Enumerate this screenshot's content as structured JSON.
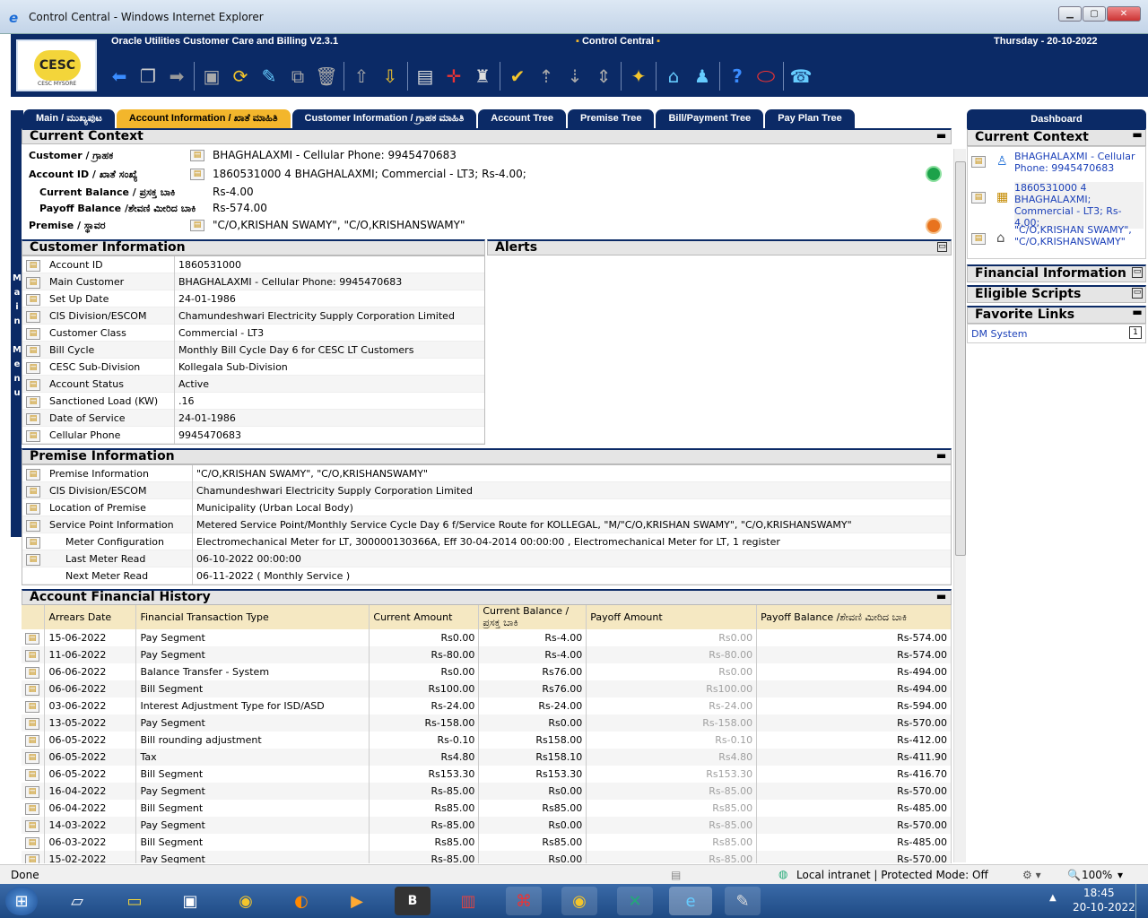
{
  "window": {
    "title": "Control Central - Windows Internet Explorer"
  },
  "banner": {
    "app": "Oracle Utilities Customer Care and Billing V2.3.1",
    "portal": "Control Central",
    "date": "Thursday - 20-10-2022",
    "logo_text": "CESC MYSORE"
  },
  "toolbar_icons": [
    "back-arrow-icon",
    "copy-icon",
    "forward-arrow-icon",
    "save-icon",
    "refresh-icon",
    "clear-icon",
    "duplicate-icon",
    "delete-icon",
    "previous-record-icon",
    "next-record-icon",
    "context-menu-icon",
    "to-do-icon",
    "user-icon",
    "approve-icon",
    "up-icon",
    "down-icon",
    "sort-icon",
    "wand-icon",
    "home-icon",
    "bookmark-icon",
    "help-icon",
    "oracle-icon",
    "phone-icon"
  ],
  "side_menu": "Main Menu",
  "tabs": [
    "Main / ಮುಖ್ಯಪುಟ",
    "Account Information / ಖಾತೆ ಮಾಹಿತಿ",
    "Customer Information / ಗ್ರಾಹಕ ಮಾಹಿತಿ",
    "Account Tree",
    "Premise Tree",
    "Bill/Payment Tree",
    "Pay Plan Tree"
  ],
  "current_context": {
    "title": "Current Context",
    "customer_label": "Customer / ಗ್ರಾಹಕ",
    "customer_value": "BHAGHALAXMI - Cellular Phone: 9945470683",
    "account_label": "Account ID / ಖಾತೆ ಸಂಖ್ಯೆ",
    "account_value": "1860531000 4 BHAGHALAXMI; Commercial - LT3; Rs-4.00;",
    "balance_label": "Current Balance / ಪ್ರಸಕ್ತ ಬಾಕಿ",
    "balance_value": "Rs-4.00",
    "payoff_label": "Payoff Balance /ಶೇವಣಿ ಮೀರಿದ ಬಾಕಿ",
    "payoff_value": "Rs-574.00",
    "premise_label": "Premise / ಸ್ಥಾವರ",
    "premise_value": "\"C/O,KRISHAN SWAMY\", \"C/O,KRISHANSWAMY\""
  },
  "customer_info": {
    "title": "Customer Information",
    "rows": [
      [
        "Account ID",
        "1860531000"
      ],
      [
        "Main Customer",
        "BHAGHALAXMI - Cellular Phone: 9945470683"
      ],
      [
        "Set Up Date",
        "24-01-1986"
      ],
      [
        "CIS Division/ESCOM",
        "Chamundeshwari Electricity Supply Corporation Limited"
      ],
      [
        "Customer Class",
        "Commercial - LT3"
      ],
      [
        "Bill Cycle",
        "Monthly Bill Cycle Day 6 for CESC LT Customers"
      ],
      [
        "CESC Sub-Division",
        "Kollegala Sub-Division"
      ],
      [
        "Account Status",
        "Active"
      ],
      [
        "Sanctioned Load (KW)",
        ".16"
      ],
      [
        "Date of Service",
        "24-01-1986"
      ],
      [
        "Cellular Phone",
        "9945470683"
      ]
    ]
  },
  "alerts": {
    "title": "Alerts"
  },
  "premise_info": {
    "title": "Premise Information",
    "rows": [
      [
        "Premise Information",
        "\"C/O,KRISHAN SWAMY\", \"C/O,KRISHANSWAMY\""
      ],
      [
        "CIS Division/ESCOM",
        "Chamundeshwari Electricity Supply Corporation Limited"
      ],
      [
        "Location of Premise",
        "Municipality (Urban Local Body)"
      ],
      [
        "Service Point Information",
        "Metered Service Point/Monthly Service Cycle Day 6 f/Service Route for KOLLEGAL, \"M/\"C/O,KRISHAN SWAMY\", \"C/O,KRISHANSWAMY\""
      ],
      [
        "Meter Configuration",
        "Electromechanical Meter for LT, 300000130366A, Eff 30-04-2014 00:00:00 , Electromechanical Meter for LT, 1 register"
      ],
      [
        "Last Meter Read",
        "06-10-2022 00:00:00"
      ],
      [
        "Next Meter Read",
        "06-11-2022 ( Monthly Service )"
      ]
    ]
  },
  "financial_history": {
    "title": "Account Financial History",
    "columns": [
      "Arrears Date",
      "Financial Transaction Type",
      "Current Amount",
      "Current Balance / ಪ್ರಸಕ್ತ ಬಾಕಿ",
      "Payoff Amount",
      "Payoff Balance /ಶೇವಣಿ ಮೀರಿದ ಬಾಕಿ"
    ],
    "rows": [
      [
        "15-06-2022",
        "Pay Segment",
        "Rs0.00",
        "Rs-4.00",
        "Rs0.00",
        "Rs-574.00"
      ],
      [
        "11-06-2022",
        "Pay Segment",
        "Rs-80.00",
        "Rs-4.00",
        "Rs-80.00",
        "Rs-574.00"
      ],
      [
        "06-06-2022",
        "Balance Transfer - System",
        "Rs0.00",
        "Rs76.00",
        "Rs0.00",
        "Rs-494.00"
      ],
      [
        "06-06-2022",
        "Bill Segment",
        "Rs100.00",
        "Rs76.00",
        "Rs100.00",
        "Rs-494.00"
      ],
      [
        "03-06-2022",
        "Interest Adjustment Type for ISD/ASD",
        "Rs-24.00",
        "Rs-24.00",
        "Rs-24.00",
        "Rs-594.00"
      ],
      [
        "13-05-2022",
        "Pay Segment",
        "Rs-158.00",
        "Rs0.00",
        "Rs-158.00",
        "Rs-570.00"
      ],
      [
        "06-05-2022",
        "Bill rounding adjustment",
        "Rs-0.10",
        "Rs158.00",
        "Rs-0.10",
        "Rs-412.00"
      ],
      [
        "06-05-2022",
        "Tax",
        "Rs4.80",
        "Rs158.10",
        "Rs4.80",
        "Rs-411.90"
      ],
      [
        "06-05-2022",
        "Bill Segment",
        "Rs153.30",
        "Rs153.30",
        "Rs153.30",
        "Rs-416.70"
      ],
      [
        "16-04-2022",
        "Pay Segment",
        "Rs-85.00",
        "Rs0.00",
        "Rs-85.00",
        "Rs-570.00"
      ],
      [
        "06-04-2022",
        "Bill Segment",
        "Rs85.00",
        "Rs85.00",
        "Rs85.00",
        "Rs-485.00"
      ],
      [
        "14-03-2022",
        "Pay Segment",
        "Rs-85.00",
        "Rs0.00",
        "Rs-85.00",
        "Rs-570.00"
      ],
      [
        "06-03-2022",
        "Bill Segment",
        "Rs85.00",
        "Rs85.00",
        "Rs85.00",
        "Rs-485.00"
      ],
      [
        "15-02-2022",
        "Pay Segment",
        "Rs-85.00",
        "Rs0.00",
        "Rs-85.00",
        "Rs-570.00"
      ]
    ]
  },
  "dashboard": {
    "title": "Dashboard",
    "current_context_title": "Current Context",
    "ctx_customer": "BHAGHALAXMI - Cellular Phone: 9945470683",
    "ctx_account": "1860531000 4 BHAGHALAXMI; Commercial - LT3; Rs-4.00;",
    "ctx_premise": "\"C/O,KRISHAN SWAMY\", \"C/O,KRISHANSWAMY\"",
    "financial_info": "Financial Information",
    "eligible_scripts": "Eligible Scripts",
    "favorite_links": "Favorite Links",
    "fav_link": "DM System",
    "fav_badge": "1"
  },
  "statusbar": {
    "left": "Done",
    "zone": "Local intranet | Protected Mode: Off",
    "zoom": "100%"
  },
  "taskbar": {
    "time": "18:45",
    "date": "20-10-2022",
    "b_label": "B"
  }
}
